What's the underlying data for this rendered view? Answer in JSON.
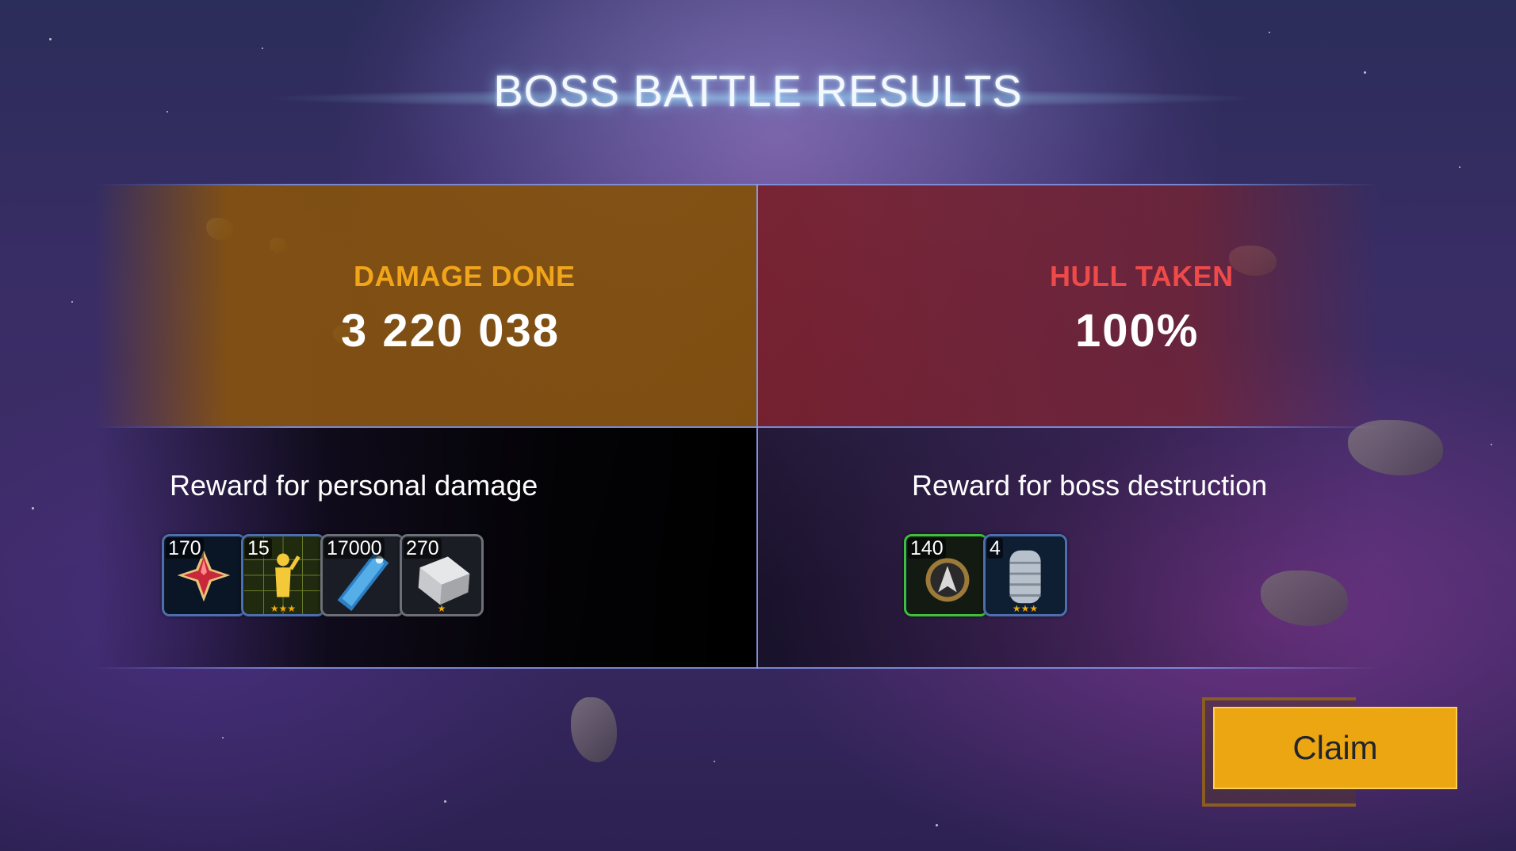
{
  "title": "BOSS BATTLE RESULTS",
  "stats": {
    "damage": {
      "label": "DAMAGE DONE",
      "value": "3 220 038",
      "color": "#f0a51a"
    },
    "hull": {
      "label": "HULL TAKEN",
      "value": "100%",
      "color": "#ef4a4a"
    }
  },
  "rewards": {
    "personal": {
      "title": "Reward for personal damage",
      "items": [
        {
          "count": "170",
          "icon": "red-star-icon"
        },
        {
          "count": "15",
          "icon": "gold-officer-icon",
          "rarity_stars": "★★★"
        },
        {
          "count": "17000",
          "icon": "blue-blueprint-icon"
        },
        {
          "count": "270",
          "icon": "silver-block-icon",
          "rarity_stars": "★"
        }
      ]
    },
    "destruction": {
      "title": "Reward for boss destruction",
      "items": [
        {
          "count": "140",
          "icon": "starfleet-badge-icon"
        },
        {
          "count": "4",
          "icon": "metal-cylinder-icon",
          "rarity_stars": "★★★"
        }
      ]
    }
  },
  "claim_label": "Claim"
}
